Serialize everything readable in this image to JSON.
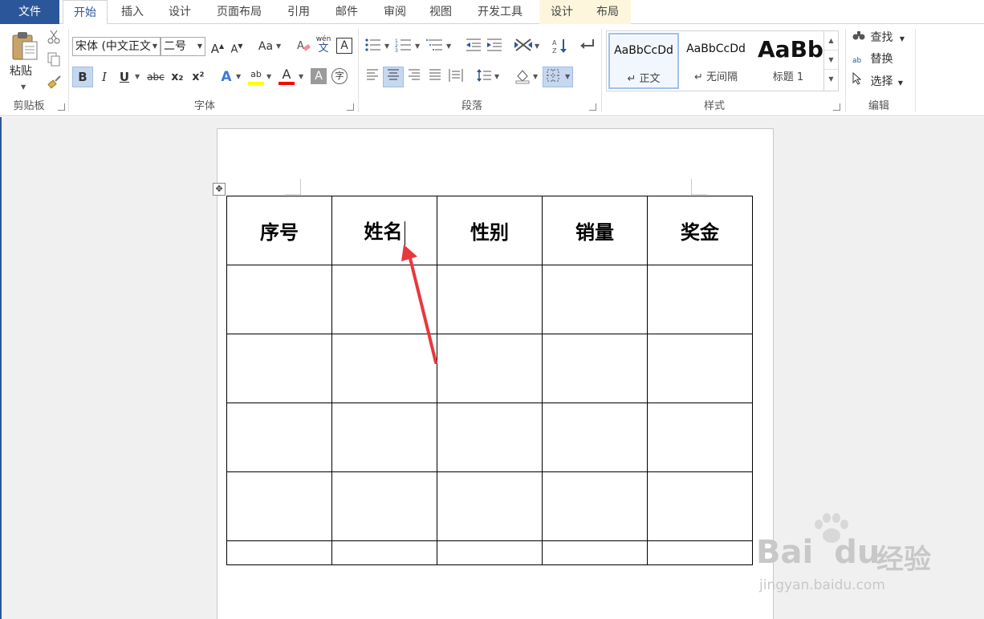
{
  "tabs": [
    {
      "label": "文件",
      "kind": "file"
    },
    {
      "label": "开始",
      "kind": "active"
    },
    {
      "label": "插入",
      "kind": "normal"
    },
    {
      "label": "设计",
      "kind": "normal"
    },
    {
      "label": "页面布局",
      "kind": "normal"
    },
    {
      "label": "引用",
      "kind": "normal"
    },
    {
      "label": "邮件",
      "kind": "normal"
    },
    {
      "label": "审阅",
      "kind": "normal"
    },
    {
      "label": "视图",
      "kind": "normal"
    },
    {
      "label": "开发工具",
      "kind": "normal"
    },
    {
      "label": "设计",
      "kind": "context"
    },
    {
      "label": "布局",
      "kind": "context"
    }
  ],
  "ribbon": {
    "clipboard": {
      "paste_label": "粘贴",
      "group_label": "剪贴板"
    },
    "font": {
      "font_name": "宋体 (中文正文",
      "font_size": "二号",
      "group_label": "字体",
      "grow_glyph": "A",
      "shrink_glyph": "A",
      "case_glyph": "Aa",
      "phonetic_glyph": "wén",
      "phonetic_char": "文",
      "border_char_glyph": "A",
      "bold_glyph": "B",
      "italic_glyph": "I",
      "underline_glyph": "U",
      "strike_glyph": "abc",
      "sub_glyph": "x₂",
      "sup_glyph": "x²",
      "effects_glyph": "A",
      "highlight_glyph": "ab",
      "fontcolor_glyph": "A",
      "shading_glyph": "A",
      "enclose_glyph": "字"
    },
    "paragraph": {
      "group_label": "段落"
    },
    "styles": {
      "group_label": "样式",
      "items": [
        {
          "sample": "AaBbCcDd",
          "name": "↵ 正文"
        },
        {
          "sample": "AaBbCcDd",
          "name": "↵ 无间隔"
        },
        {
          "sample": "AaBb",
          "name": "标题 1"
        }
      ]
    },
    "editing": {
      "group_label": "编辑",
      "find": "查找",
      "replace": "替换",
      "select": "选择"
    }
  },
  "colors": {
    "brand": "#2b579a",
    "highlight": "#ffff00",
    "font_color": "#ff0000",
    "annotation_arrow": "#e8383d"
  },
  "table": {
    "headers": [
      "序号",
      "姓名",
      "性别",
      "销量",
      "奖金"
    ],
    "empty_rows": 5
  },
  "watermark": {
    "brand": "Bai",
    "brand2": "du",
    "cn": "经验",
    "url": "jingyan.baidu.com"
  }
}
